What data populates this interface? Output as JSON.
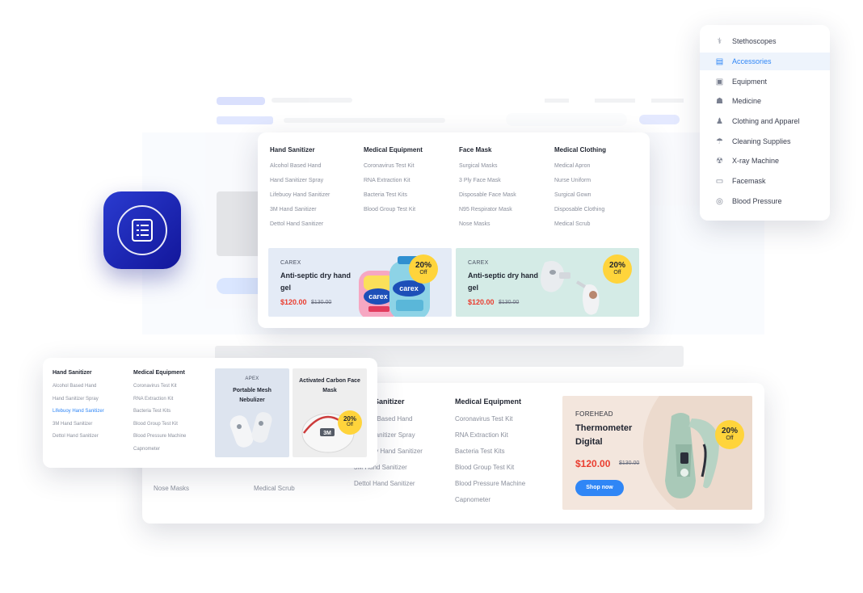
{
  "top_menu": {
    "columns": [
      {
        "title": "Hand Sanitizer",
        "links": [
          "Alcohol Based Hand",
          "Hand Sanitizer Spray",
          "Lifebuoy Hand Sanitizer",
          "3M Hand Sanitizer",
          "Dettol Hand Sanitizer"
        ]
      },
      {
        "title": "Medical Equipment",
        "links": [
          "Coronavirus Test Kit",
          "RNA Extraction Kit",
          "Bacteria Test Kits",
          "Blood Group Test Kit"
        ]
      },
      {
        "title": "Face Mask",
        "links": [
          "Surgical Masks",
          "3 Ply Face Mask",
          "Disposable Face Mask",
          "N95 Respirator Mask",
          "Nose Masks"
        ]
      },
      {
        "title": "Medical Clothing",
        "links": [
          "Medical Apron",
          "Nurse Uniform",
          "Surgical Gown",
          "Disposable Clothing",
          "Medical Scrub"
        ]
      }
    ],
    "promos": [
      {
        "brand": "CAREX",
        "name": "Anti-septic dry hand gel",
        "price": "$120.00",
        "old_price": "$130.00",
        "badge_pct": "20%",
        "badge_off": "Off",
        "bg": "#e4ebf6",
        "bottle_label": "carex"
      },
      {
        "brand": "CAREX",
        "name": "Anti-septic dry hand gel",
        "price": "$120.00",
        "old_price": "$130.00",
        "badge_pct": "20%",
        "badge_off": "Off",
        "bg": "#d4ebe6"
      }
    ]
  },
  "dropdown": {
    "selected_index": 1,
    "items": [
      {
        "label": "Stethoscopes",
        "icon": "stethoscope-icon"
      },
      {
        "label": "Accessories",
        "icon": "accessories-icon"
      },
      {
        "label": "Equipment",
        "icon": "equipment-icon"
      },
      {
        "label": "Medicine",
        "icon": "medicine-icon"
      },
      {
        "label": "Clothing and Apparel",
        "icon": "clothing-icon"
      },
      {
        "label": "Cleaning Supplies",
        "icon": "cleaning-icon"
      },
      {
        "label": "X-ray Machine",
        "icon": "xray-icon"
      },
      {
        "label": "Facemask",
        "icon": "facemask-icon"
      },
      {
        "label": "Blood Pressure",
        "icon": "blood-pressure-icon"
      }
    ]
  },
  "bottom_menu": {
    "col1_partial": [
      "Nose Masks"
    ],
    "col2_partial": [
      "Medical Scrub"
    ],
    "col3": {
      "title": "Hand Sanitizer",
      "links": [
        "Alcohol Based Hand",
        "Hand Sanitizer Spray",
        "Lifebuoy Hand Sanitizer",
        "3M Hand Sanitizer",
        "Dettol Hand Sanitizer"
      ]
    },
    "col4": {
      "title": "Medical Equipment",
      "links": [
        "Coronavirus Test Kit",
        "RNA Extraction Kit",
        "Bacteria Test Kits",
        "Blood Group Test Kit",
        "Blood Pressure Machine",
        "Capnometer"
      ]
    },
    "feature": {
      "brand": "FOREHEAD",
      "name": "Thermometer Digital",
      "price": "$120.00",
      "old_price": "$130.00",
      "badge_pct": "20%",
      "badge_off": "Off",
      "cta": "Shop now"
    }
  },
  "left_menu": {
    "col1": {
      "title": "Hand Sanitizer",
      "links": [
        "Alcohol Based Hand",
        "Hand Sanitizer Spray",
        "Lifebuoy Hand Sanitizer",
        "3M Hand Sanitizer",
        "Dettol Hand Sanitizer"
      ],
      "active_index": 2
    },
    "col2": {
      "title": "Medical Equipment",
      "links": [
        "Coronavirus Test Kit",
        "RNA Extraction Kit",
        "Bacteria Test Kits",
        "Blood Group Test Kit",
        "Blood Pressure Machine",
        "Capnometer"
      ]
    },
    "tiles": [
      {
        "brand": "APEX",
        "name": "Portable Mesh Nebulizer"
      },
      {
        "brand": "",
        "name": "Activated Carbon Face Mask",
        "badge_pct": "20%",
        "badge_off": "Off",
        "mask_label": "3M"
      }
    ]
  },
  "colors": {
    "accent": "#2f86f6",
    "price": "#ea3d2f",
    "badge": "#ffd43b",
    "app_icon": "#1a22b8"
  }
}
